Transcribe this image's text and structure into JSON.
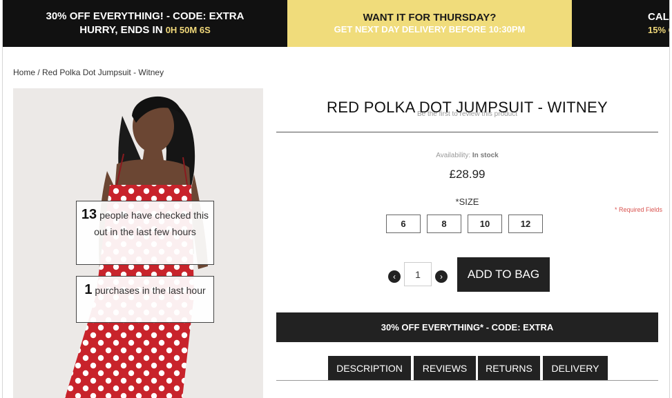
{
  "promo": {
    "offer_line1": "30% OFF EVERYTHING! - CODE: EXTRA",
    "offer_line2": "HURRY, ENDS IN",
    "timer": "0H 50M 6S",
    "delivery_title": "WANT IT FOR THURSDAY?",
    "delivery_sub": "GET NEXT DAY DELIVERY BEFORE 10:30PM",
    "partial_title": "CAL",
    "partial_sub": "15% O"
  },
  "breadcrumb": "Home / Red Polka Dot Jumpsuit - Witney",
  "social_proof": {
    "viewers_count": "13",
    "viewers_text": "people have checked this out in the last few hours",
    "purchases_count": "1",
    "purchases_text": "purchases in the last hour"
  },
  "product": {
    "title": "RED POLKA DOT JUMPSUIT - WITNEY",
    "review_prompt": "Be the first to review this product",
    "availability_label": "Availability:",
    "availability_value": "In stock",
    "price": "£28.99",
    "size_label": "*SIZE",
    "required_note": "* Required Fields",
    "sizes": [
      "6",
      "8",
      "10",
      "12"
    ],
    "quantity": "1",
    "add_to_bag": "ADD TO BAG"
  },
  "discount_banner": "30% OFF EVERYTHING* - CODE: EXTRA",
  "tabs": [
    "DESCRIPTION",
    "REVIEWS",
    "RETURNS",
    "DELIVERY"
  ],
  "icons": {
    "minus": "minus-icon",
    "plus": "plus-icon"
  },
  "colors": {
    "dark": "#222222",
    "yellow": "#f0dc7b",
    "accent_gold": "#f0d87a",
    "required": "#d9534f"
  }
}
